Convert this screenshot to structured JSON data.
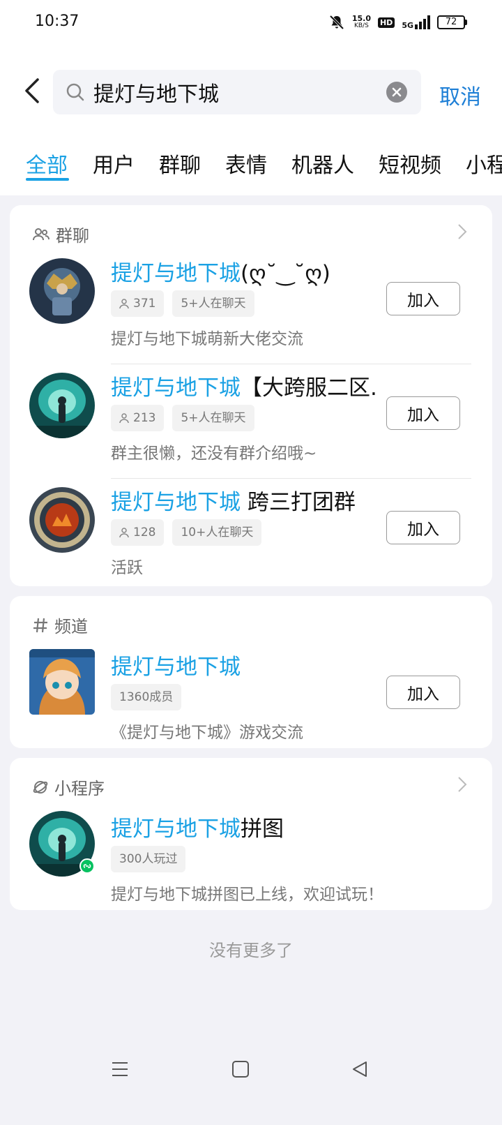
{
  "status": {
    "time": "10:37",
    "net_speed": "15.0",
    "net_unit": "KB/S",
    "hd": "HD",
    "network": "5G",
    "battery": "72"
  },
  "search": {
    "query": "提灯与地下城",
    "cancel_label": "取消"
  },
  "tabs": [
    "全部",
    "用户",
    "群聊",
    "表情",
    "机器人",
    "短视频",
    "小程序"
  ],
  "groups": {
    "title": "群聊",
    "items": [
      {
        "title_hl": "提灯与地下城",
        "title_rest": "(ღ˘‿˘ღ)",
        "members": "371",
        "online": "5+人在聊天",
        "desc": "提灯与地下城萌新大佬交流",
        "button": "加入"
      },
      {
        "title_hl": "提灯与地下城",
        "title_rest": "【大跨服二区...",
        "members": "213",
        "online": "5+人在聊天",
        "desc": "群主很懒，还没有群介绍哦~",
        "button": "加入"
      },
      {
        "title_hl": "提灯与地下城",
        "title_rest": " 跨三打团群",
        "members": "128",
        "online": "10+人在聊天",
        "desc": "活跃",
        "button": "加入"
      }
    ]
  },
  "channels": {
    "title": "频道",
    "items": [
      {
        "title_hl": "提灯与地下城",
        "title_rest": "",
        "members": "1360成员",
        "desc": "《提灯与地下城》游戏交流",
        "button": "加入"
      }
    ]
  },
  "miniprograms": {
    "title": "小程序",
    "items": [
      {
        "title_hl": "提灯与地下城",
        "title_rest": "拼图",
        "players": "300人玩过",
        "desc": "提灯与地下城拼图已上线，欢迎试玩！"
      }
    ]
  },
  "end_text": "没有更多了",
  "colors": {
    "accent": "#1aa1e4",
    "cancel": "#1e7fd6",
    "background": "#f2f2f7"
  }
}
